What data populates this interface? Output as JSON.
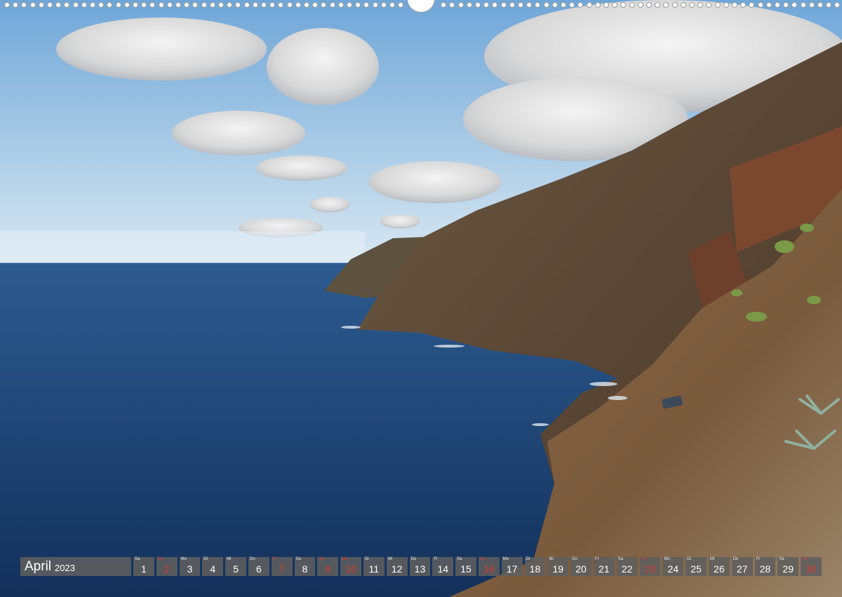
{
  "calendar": {
    "month": "April",
    "year": "2023",
    "days": [
      {
        "wd": "Sa",
        "num": "1",
        "red": false
      },
      {
        "wd": "So",
        "num": "2",
        "red": true
      },
      {
        "wd": "Mo",
        "num": "3",
        "red": false
      },
      {
        "wd": "Di",
        "num": "4",
        "red": false
      },
      {
        "wd": "Mi",
        "num": "5",
        "red": false
      },
      {
        "wd": "Do",
        "num": "6",
        "red": false
      },
      {
        "wd": "Fr",
        "num": "7",
        "red": true
      },
      {
        "wd": "Sa",
        "num": "8",
        "red": false
      },
      {
        "wd": "So",
        "num": "9",
        "red": true
      },
      {
        "wd": "Mo",
        "num": "10",
        "red": true
      },
      {
        "wd": "Di",
        "num": "11",
        "red": false
      },
      {
        "wd": "Mi",
        "num": "12",
        "red": false
      },
      {
        "wd": "Do",
        "num": "13",
        "red": false
      },
      {
        "wd": "Fr",
        "num": "14",
        "red": false
      },
      {
        "wd": "Sa",
        "num": "15",
        "red": false
      },
      {
        "wd": "So",
        "num": "16",
        "red": true
      },
      {
        "wd": "Mo",
        "num": "17",
        "red": false
      },
      {
        "wd": "Di",
        "num": "18",
        "red": false
      },
      {
        "wd": "Mi",
        "num": "19",
        "red": false
      },
      {
        "wd": "Do",
        "num": "20",
        "red": false
      },
      {
        "wd": "Fr",
        "num": "21",
        "red": false
      },
      {
        "wd": "Sa",
        "num": "22",
        "red": false
      },
      {
        "wd": "So",
        "num": "23",
        "red": true
      },
      {
        "wd": "Mo",
        "num": "24",
        "red": false
      },
      {
        "wd": "Di",
        "num": "25",
        "red": false
      },
      {
        "wd": "Mi",
        "num": "26",
        "red": false
      },
      {
        "wd": "Do",
        "num": "27",
        "red": false
      },
      {
        "wd": "Fr",
        "num": "28",
        "red": false
      },
      {
        "wd": "Sa",
        "num": "29",
        "red": false
      },
      {
        "wd": "So",
        "num": "30",
        "red": true
      }
    ]
  },
  "colors": {
    "holiday": "#d83a30",
    "bar": "#5f5f5f",
    "sea": "#1d3f6e",
    "sky": "#7fb1dc"
  }
}
